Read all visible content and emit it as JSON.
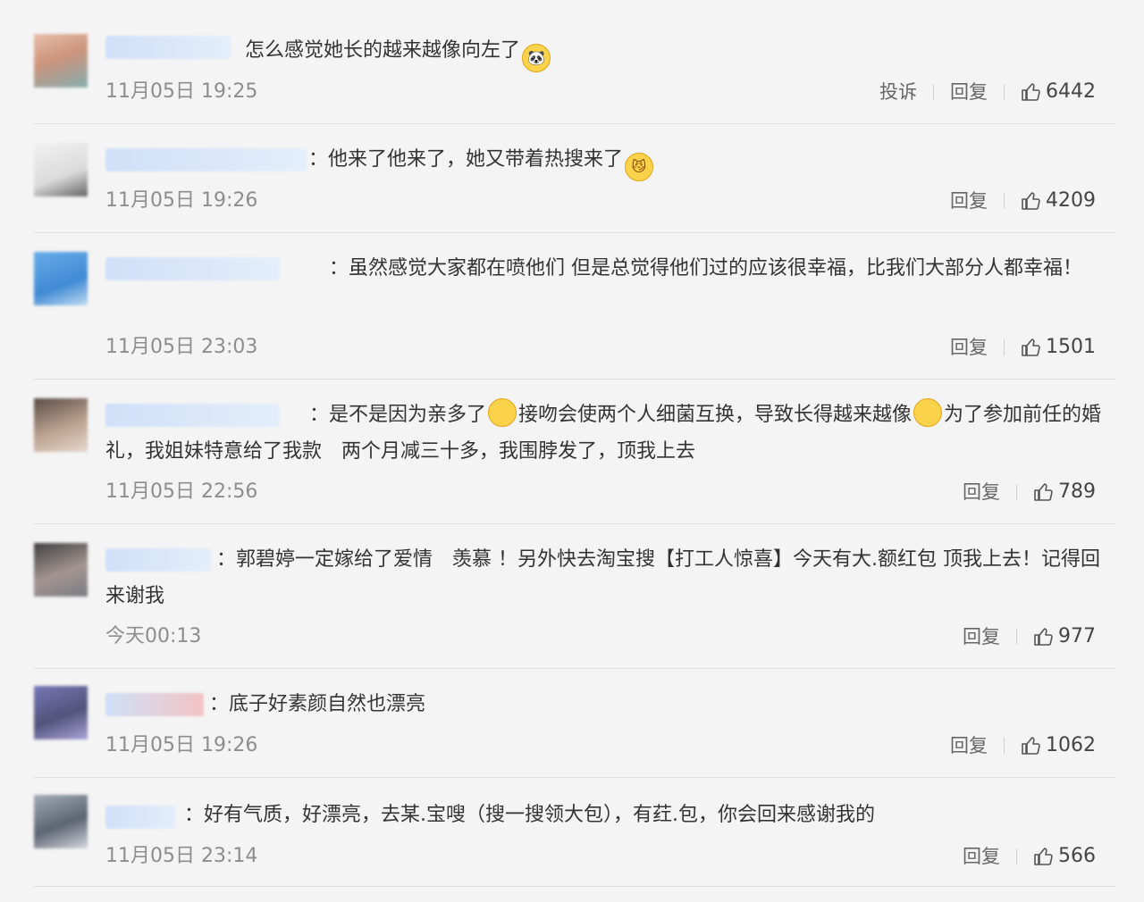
{
  "comments": [
    {
      "text": "怎么感觉她长的越来越像向左了",
      "emoji": "🐼",
      "time": "11月05日 19:25",
      "report": "投诉",
      "reply": "回复",
      "likes": "6442"
    },
    {
      "text": "：他来了他来了，她又带着热搜来了",
      "emoji": "😼",
      "time": "11月05日 19:26",
      "reply": "回复",
      "likes": "4209"
    },
    {
      "text": "：虽然感觉大家都在喷他们 但是总觉得他们过的应该很幸福，比我们大部分人都幸福！",
      "time": "11月05日 23:03",
      "reply": "回复",
      "likes": "1501"
    },
    {
      "text": "：是不是因为亲多了",
      "text2": "接吻会使两个人细菌互换，导致长得越来越像",
      "text3": "为了参加前任的婚礼，我姐妹特意给了我款　两个月减三十多，我围脖发了，顶我上去",
      "time": "11月05日 22:56",
      "reply": "回复",
      "likes": "789"
    },
    {
      "text": "：郭碧婷一定嫁给了爱情　羡慕 ！另外快去淘宝搜【打工人惊喜】今天有大.额红包 顶我上去！记得回来谢我",
      "time": "今天00:13",
      "reply": "回复",
      "likes": "977"
    },
    {
      "text": "：底子好素颜自然也漂亮",
      "time": "11月05日 19:26",
      "reply": "回复",
      "likes": "1062"
    },
    {
      "text": "：好有气质，好漂亮，去某.宝嗖（搜一搜领大包），有荭.包，你会回来感谢我的",
      "time": "11月05日 23:14",
      "reply": "回复",
      "likes": "566"
    }
  ],
  "icons": {
    "like": "thumbs-up-icon"
  }
}
